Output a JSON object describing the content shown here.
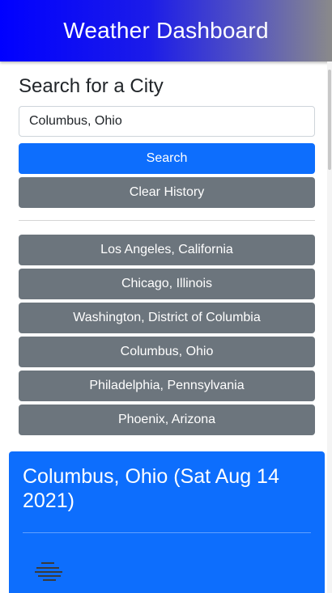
{
  "header": {
    "title": "Weather Dashboard"
  },
  "search": {
    "title": "Search for a City",
    "input_value": "Columbus, Ohio",
    "search_label": "Search",
    "clear_label": "Clear History"
  },
  "history": [
    {
      "label": "Los Angeles, California"
    },
    {
      "label": "Chicago, Illinois"
    },
    {
      "label": "Washington, District of Columbia"
    },
    {
      "label": "Columbus, Ohio"
    },
    {
      "label": "Philadelphia, Pennsylvania"
    },
    {
      "label": "Phoenix, Arizona"
    }
  ],
  "current": {
    "title": "Columbus, Ohio (Sat Aug 14 2021)",
    "icon": "fog-icon"
  },
  "colors": {
    "primary": "#0d6efd",
    "secondary": "#6c757d",
    "header_start": "#0000ff",
    "header_end": "#8a8a8a"
  }
}
